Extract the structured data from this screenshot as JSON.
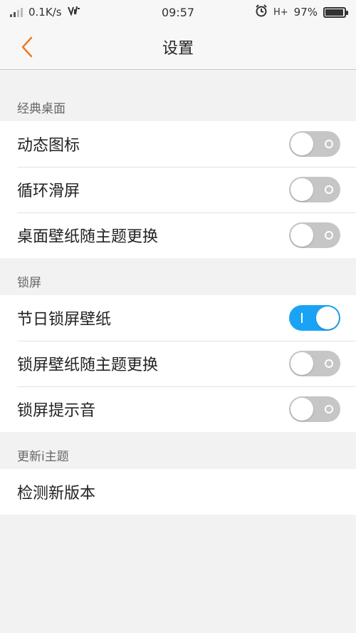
{
  "status_bar": {
    "speed": "0.1K/s",
    "time": "09:57",
    "network": "H+",
    "battery": "97%",
    "battery_level": 0.97
  },
  "header": {
    "title": "设置",
    "accent_color": "#f07a28"
  },
  "sections": [
    {
      "title": "经典桌面",
      "items": [
        {
          "label": "动态图标",
          "on": false
        },
        {
          "label": "循环滑屏",
          "on": false
        },
        {
          "label": "桌面壁纸随主题更换",
          "on": false
        }
      ]
    },
    {
      "title": "锁屏",
      "items": [
        {
          "label": "节日锁屏壁纸",
          "on": true
        },
        {
          "label": "锁屏壁纸随主题更换",
          "on": false
        },
        {
          "label": "锁屏提示音",
          "on": false
        }
      ]
    },
    {
      "title": "更新i主题",
      "items": [
        {
          "label": "检测新版本"
        }
      ]
    }
  ],
  "colors": {
    "toggle_on": "#1aa3f5",
    "toggle_off": "#c6c6c6"
  }
}
